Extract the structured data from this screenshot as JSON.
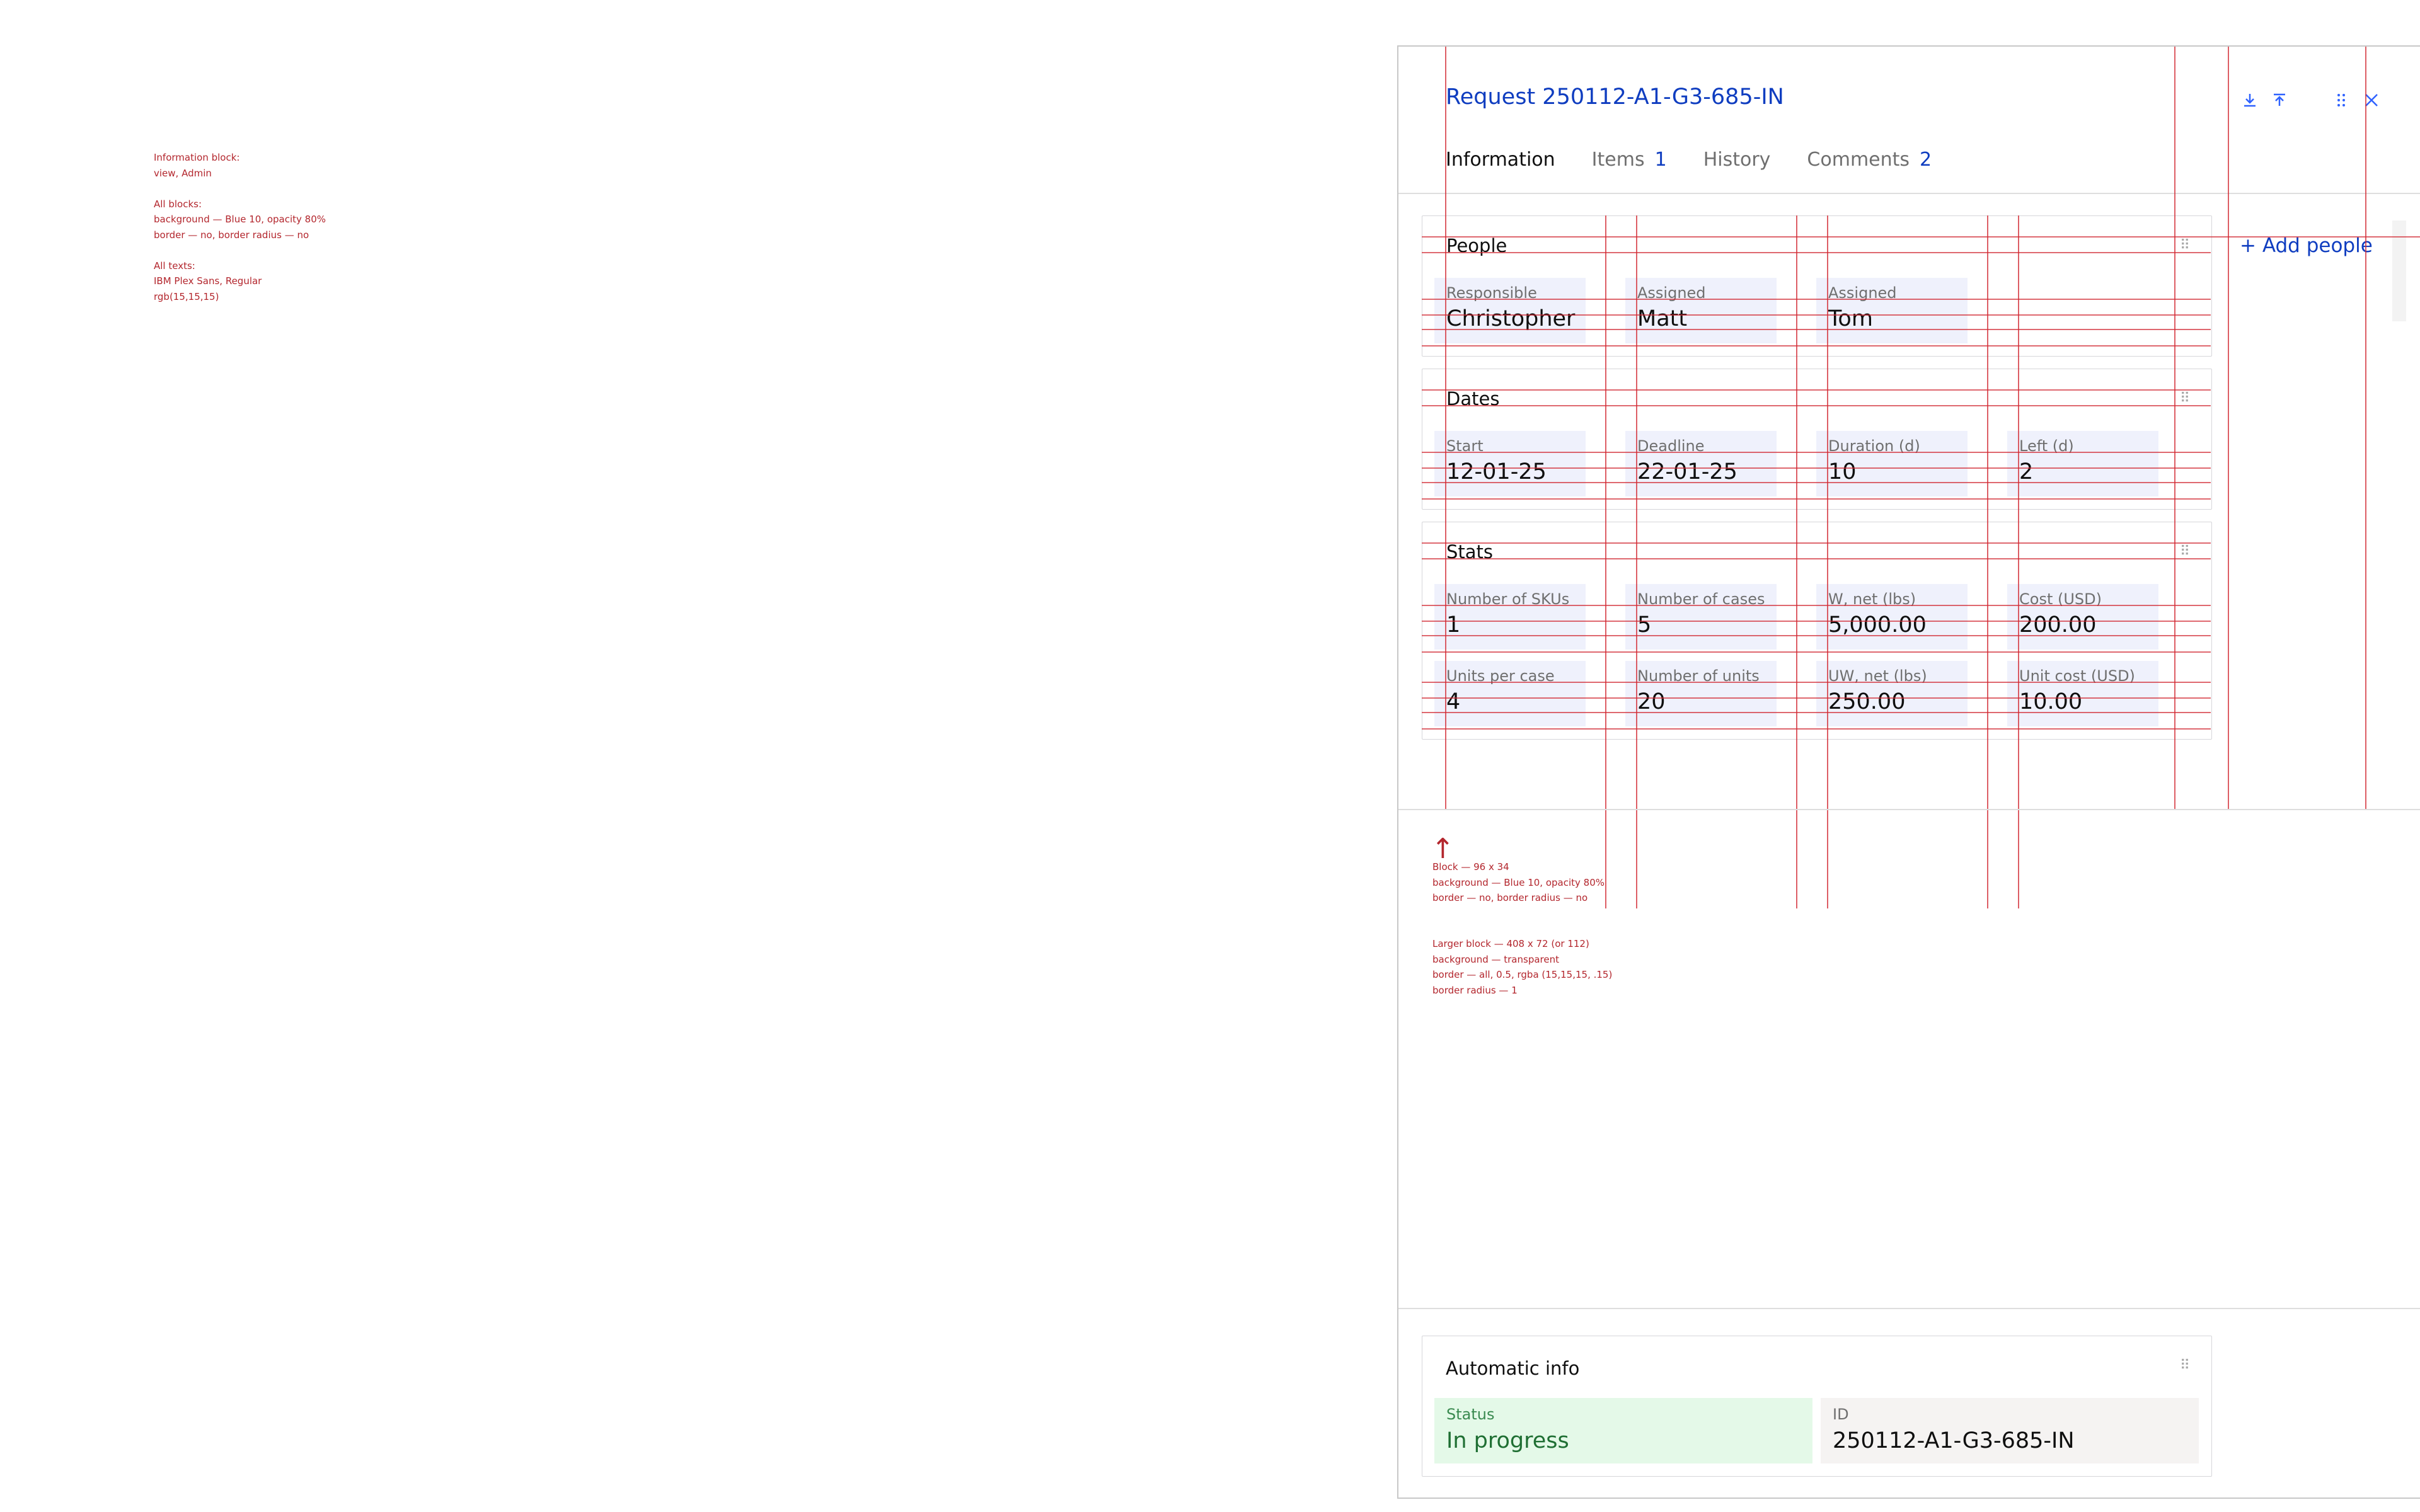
{
  "notes": {
    "left": "Information block:\nview, Admin\n\nAll blocks:\nbackground — Blue 10, opacity 80%\nborder — no, border radius — no\n\nAll texts:\nIBM Plex Sans, Regular\nrgb(15,15,15)",
    "block": "Block — 96 x 34\nbackground — Blue 10, opacity 80%\nborder — no, border radius — no",
    "larger": "Larger block — 408 x 72 (or 112)\nbackground — transparent\nborder — all, 0.5, rgba (15,15,15, .15)\nborder radius — 1",
    "arrow": "↑"
  },
  "panel": {
    "title": "Request 250112-A1-G3-685-IN",
    "icons": {
      "download": "download-icon",
      "upload": "upload-icon",
      "drag": "drag-handle-icon",
      "close": "close-icon"
    },
    "tabs": [
      {
        "label": "Information",
        "count": ""
      },
      {
        "label": "Items",
        "count": "1"
      },
      {
        "label": "History",
        "count": ""
      },
      {
        "label": "Comments",
        "count": "2"
      }
    ],
    "add_people": "+ Add people"
  },
  "blocks": {
    "people": {
      "title": "People",
      "fields": [
        {
          "label": "Responsible",
          "value": "Christopher"
        },
        {
          "label": "Assigned",
          "value": "Matt"
        },
        {
          "label": "Assigned",
          "value": "Tom"
        }
      ]
    },
    "dates": {
      "title": "Dates",
      "fields": [
        {
          "label": "Start",
          "value": "12-01-25"
        },
        {
          "label": "Deadline",
          "value": "22-01-25"
        },
        {
          "label": "Duration (d)",
          "value": "10"
        },
        {
          "label": "Left (d)",
          "value": "2"
        }
      ]
    },
    "stats": {
      "title": "Stats",
      "fields": [
        {
          "label": "Number of SKUs",
          "value": "1"
        },
        {
          "label": "Number of cases",
          "value": "5"
        },
        {
          "label": "W, net (lbs)",
          "value": "5,000.00"
        },
        {
          "label": "Cost (USD)",
          "value": "200.00"
        },
        {
          "label": "Units per case",
          "value": "4"
        },
        {
          "label": "Number of units",
          "value": "20"
        },
        {
          "label": "UW, net (lbs)",
          "value": "250.00"
        },
        {
          "label": "Unit cost (USD)",
          "value": "10.00"
        }
      ]
    },
    "auto": {
      "title": "Automatic info",
      "fields": [
        {
          "label": "Status",
          "value": "In progress"
        },
        {
          "label": "ID",
          "value": "250112-A1-G3-685-IN"
        }
      ]
    }
  },
  "colors": {
    "accent": "#0f3dc0",
    "annotation": "#b3262d",
    "status_bg": "#e4f9e8",
    "status_text": "#1f6f33",
    "id_bg": "#f5f3f2",
    "cell_bg": "#edf0fc"
  }
}
